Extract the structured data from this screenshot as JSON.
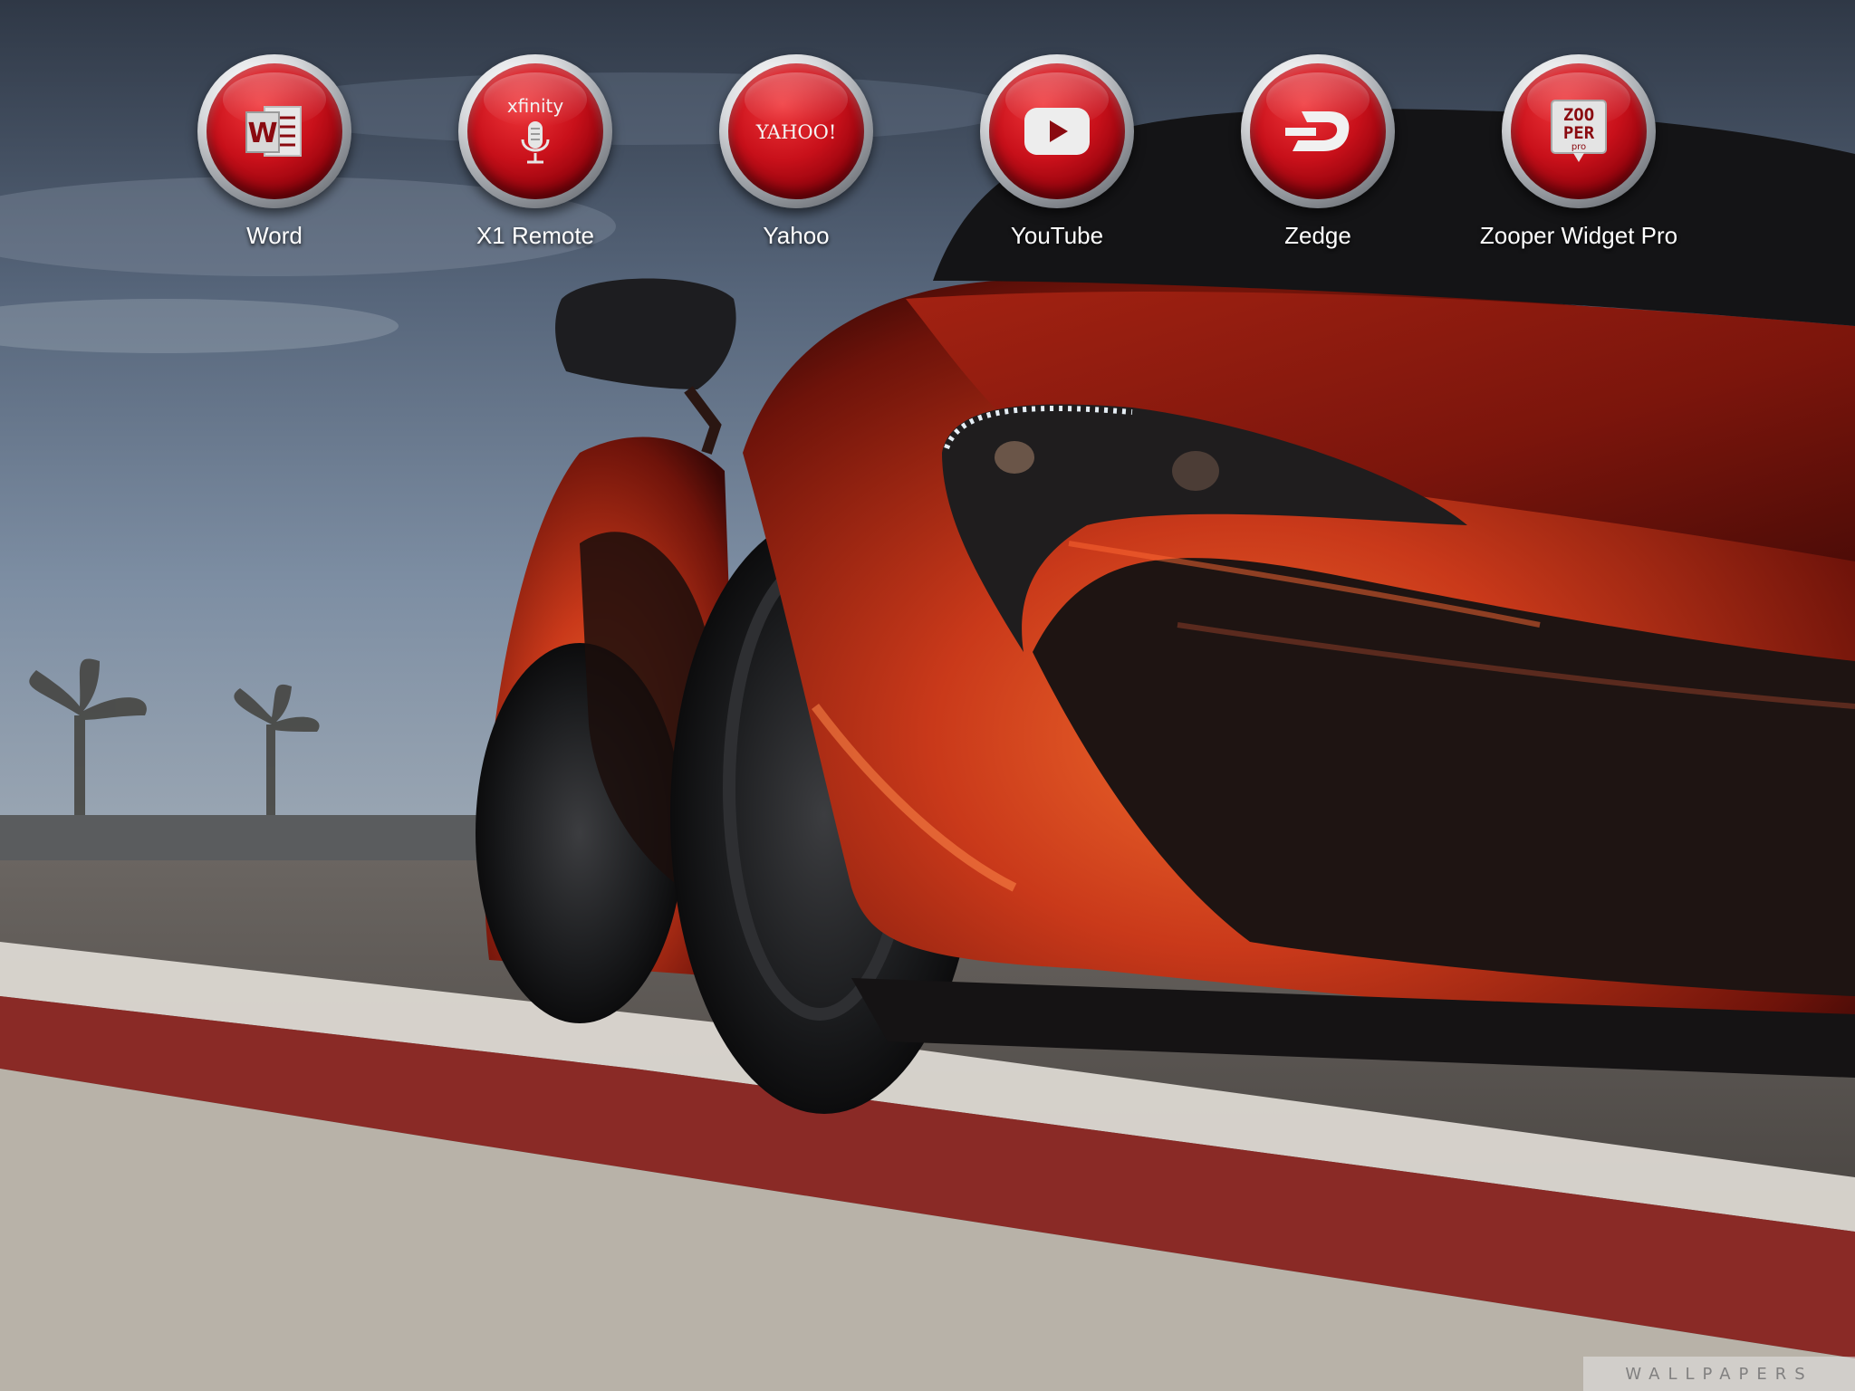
{
  "home_screen": {
    "apps": [
      {
        "label": "Word",
        "icon": "word-icon",
        "glyph": "W"
      },
      {
        "label": "X1 Remote",
        "icon": "xfinity-mic-icon",
        "glyph": "xfinity"
      },
      {
        "label": "Yahoo",
        "icon": "yahoo-icon",
        "glyph": "YAHOO!"
      },
      {
        "label": "YouTube",
        "icon": "youtube-play-icon"
      },
      {
        "label": "Zedge",
        "icon": "zedge-icon"
      },
      {
        "label": "Zooper Widget Pro",
        "icon": "zooper-icon",
        "glyph_lines": [
          "ZOO",
          "PER",
          "pro"
        ]
      }
    ]
  },
  "wallpaper": {
    "subject": "red sports car on race track",
    "watermark": "WALLPAPERS"
  },
  "colors": {
    "icon_red": "#c8101a",
    "icon_ring_silver": "#d7d9dc",
    "label_text": "#ffffff",
    "car_orange": "#d2451c"
  }
}
